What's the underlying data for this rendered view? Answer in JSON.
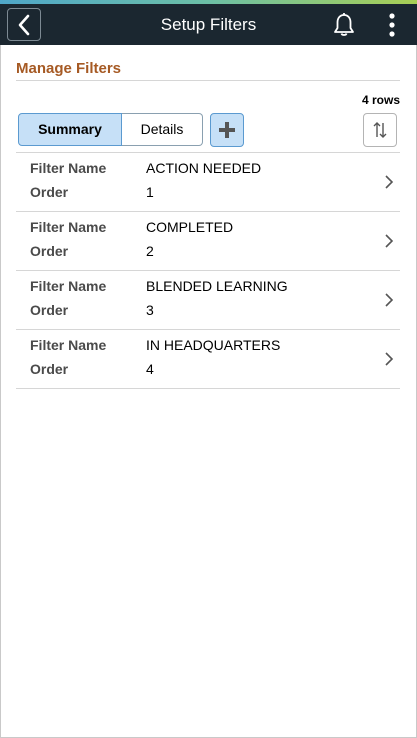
{
  "header": {
    "title": "Setup Filters",
    "back_icon": "chevron-left-icon",
    "notifications_icon": "bell-icon",
    "actions_icon": "kebab-menu-icon"
  },
  "section": {
    "title": "Manage Filters",
    "row_count": "4 rows"
  },
  "toolbar": {
    "summary_label": "Summary",
    "details_label": "Details",
    "add_icon": "plus-icon",
    "sort_icon": "sort-icon"
  },
  "labels": {
    "filter_name": "Filter Name",
    "order": "Order"
  },
  "rows": [
    {
      "filter_name": "ACTION NEEDED",
      "order": "1"
    },
    {
      "filter_name": "COMPLETED",
      "order": "2"
    },
    {
      "filter_name": "BLENDED LEARNING",
      "order": "3"
    },
    {
      "filter_name": "IN HEADQUARTERS",
      "order": "4"
    }
  ],
  "colors": {
    "banner": "#1b2730",
    "section_title": "#a65a24",
    "selected_segment": "#c6e0f7"
  }
}
